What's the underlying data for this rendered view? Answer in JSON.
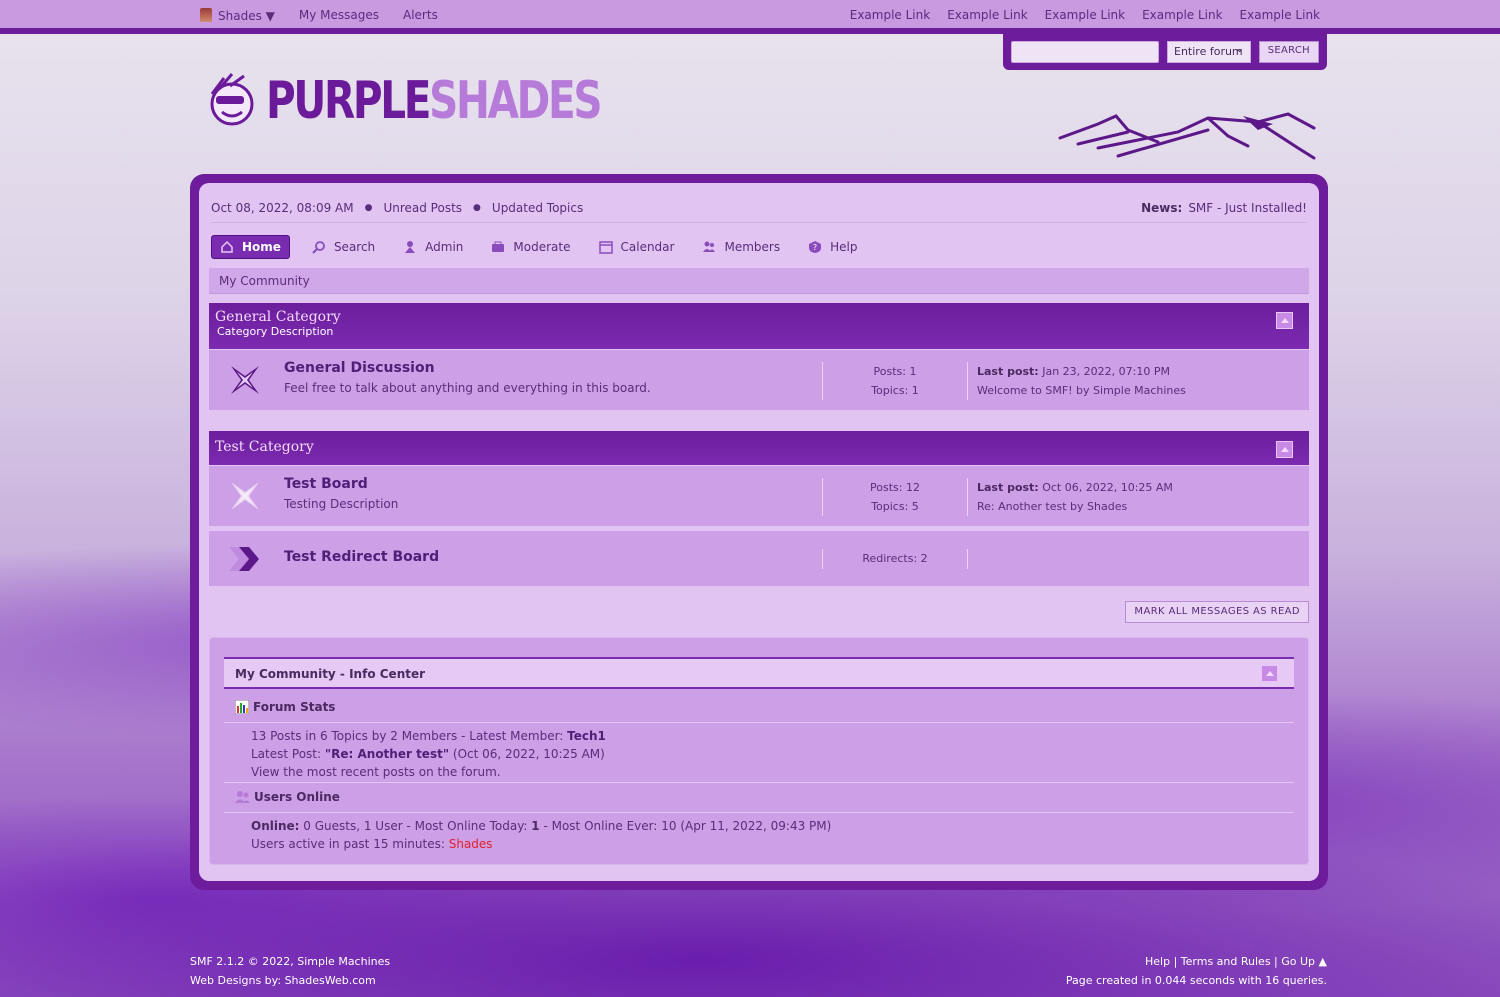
{
  "topbar": {
    "user_menu": "Shades ▼",
    "my_messages": "My Messages",
    "alerts": "Alerts",
    "links": [
      "Example Link",
      "Example Link",
      "Example Link",
      "Example Link",
      "Example Link"
    ]
  },
  "search": {
    "input_value": "",
    "scope": "Entire forum",
    "button": "SEARCH"
  },
  "logo": {
    "word1": "PURPLE",
    "word2": "SHADES"
  },
  "upper": {
    "datetime": "Oct 08, 2022, 08:09 AM",
    "unread": "Unread Posts",
    "updated": "Updated Topics",
    "news_label": "News:",
    "news_text": "SMF - Just Installed!"
  },
  "menu": [
    {
      "label": "Home",
      "icon": "home-icon"
    },
    {
      "label": "Search",
      "icon": "search-icon"
    },
    {
      "label": "Admin",
      "icon": "admin-icon"
    },
    {
      "label": "Moderate",
      "icon": "moderate-icon"
    },
    {
      "label": "Calendar",
      "icon": "calendar-icon"
    },
    {
      "label": "Members",
      "icon": "members-icon"
    },
    {
      "label": "Help",
      "icon": "help-icon"
    }
  ],
  "linktree": "My Community",
  "categories": [
    {
      "title": "General Category",
      "description": "Category Description",
      "boards": [
        {
          "name": "General Discussion",
          "description": "Feel free to talk about anything and everything in this board.",
          "posts": "Posts: 1",
          "topics": "Topics: 1",
          "last_label": "Last post:",
          "last_date": "Jan 23, 2022, 07:10 PM",
          "last_topic": "Welcome to SMF! by Simple Machines"
        }
      ]
    },
    {
      "title": "Test Category",
      "boards": [
        {
          "name": "Test Board",
          "description": "Testing Description",
          "posts": "Posts: 12",
          "topics": "Topics: 5",
          "last_label": "Last post:",
          "last_date": "Oct 06, 2022, 10:25 AM",
          "last_topic": "Re: Another test by Shades"
        },
        {
          "name": "Test Redirect Board",
          "redirects": "Redirects: 2"
        }
      ]
    }
  ],
  "mark_read": "MARK ALL MESSAGES AS READ",
  "info_center": {
    "title": "My Community - Info Center",
    "stats_title": "Forum Stats",
    "stats_line1_a": "13 Posts in 6 Topics by 2 Members - Latest Member: ",
    "stats_line1_member": "Tech1",
    "stats_line2_a": "Latest Post: ",
    "stats_line2_post": "\"Re: Another test\"",
    "stats_line2_b": " (Oct 06, 2022, 10:25 AM)",
    "stats_line3": "View the most recent posts on the forum.",
    "users_title": "Users Online",
    "online_label": "Online:",
    "online_text": " 0 Guests, 1 User  - Most Online Today: ",
    "online_today": "1",
    "online_text2": " -  Most Online Ever: 10 (Apr 11, 2022, 09:43 PM)",
    "active_text": "Users active in past 15 minutes: ",
    "active_user": "Shades"
  },
  "footer": {
    "copyright": "SMF 2.1.2 © 2022, Simple Machines",
    "designs": "Web Designs by: ShadesWeb.com",
    "links": "Help | Terms and Rules | Go Up ▲",
    "page_created": "Page created in 0.044 seconds with 16 queries."
  }
}
